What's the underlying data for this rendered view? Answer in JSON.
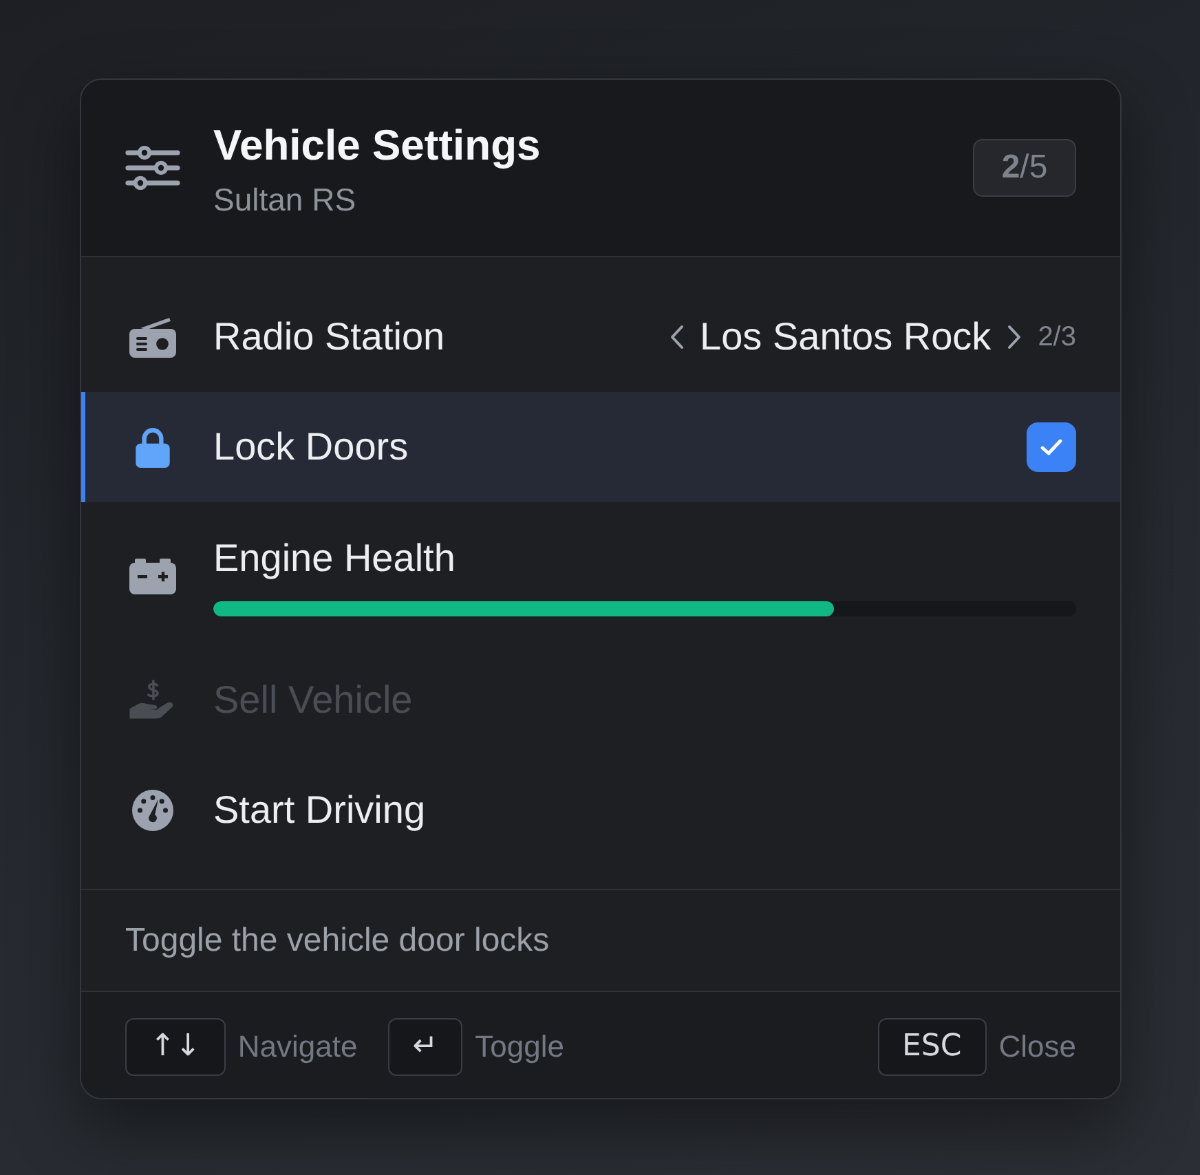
{
  "header": {
    "title": "Vehicle Settings",
    "subtitle": "Sultan RS",
    "counter": "**2**/5"
  },
  "items": [
    {
      "kind": "selector",
      "label": "Radio Station",
      "value": "Los Santos Rock",
      "position": "2/3",
      "selected": false,
      "disabled": false
    },
    {
      "kind": "checkbox",
      "label": "Lock Doors",
      "checked": true,
      "selected": true,
      "disabled": false
    },
    {
      "kind": "progress",
      "label": "Engine Health",
      "level": 0.72,
      "selected": false,
      "disabled": false
    },
    {
      "kind": "action",
      "label": "Sell Vehicle",
      "selected": false,
      "disabled": true
    },
    {
      "kind": "action",
      "label": "Start Driving",
      "selected": false,
      "disabled": false
    }
  ],
  "description": "Toggle the vehicle door locks",
  "footer": {
    "left_shortcuts": [
      {
        "key": "↑↓",
        "label": "Navigate"
      },
      {
        "key": "↵",
        "label": "Toggle"
      }
    ],
    "right_shortcuts": [
      {
        "key": "ESC",
        "label": "Close"
      }
    ]
  }
}
